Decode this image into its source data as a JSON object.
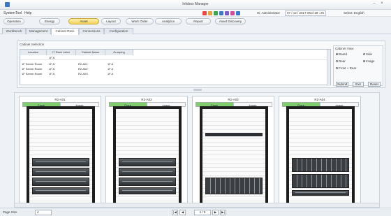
{
  "window": {
    "title": "Infobox Manager"
  },
  "menu": [
    "System",
    "Tool",
    "Help"
  ],
  "status": {
    "user": "Hi, Administrator",
    "datetime": "07 / 12 / 2017  Wed  19 : 25",
    "lang_label": "Select: English"
  },
  "toolbar": [
    "Operation",
    "Energy",
    "Asset",
    "Layout",
    "Work Order",
    "Analytics",
    "Report",
    "Asset Discovery"
  ],
  "tabs": [
    "Workbench",
    "Management",
    "Cabinet Rack",
    "Connections",
    "Configuration"
  ],
  "search": {
    "title": "Cabinet Selection",
    "columns": [
      "Location",
      "IT Rack Label",
      "Cabinet Name",
      "Grouping"
    ],
    "filter_value": "1F A",
    "rows": [
      {
        "location": "1F Server Room",
        "label": "1F A",
        "name": "R2-A01",
        "group": "1F A"
      },
      {
        "location": "1F Server Room",
        "label": "1F A",
        "name": "R2-A02",
        "group": "1F A"
      },
      {
        "location": "1F Server Room",
        "label": "1F A",
        "name": "R2-A03",
        "group": "1F A"
      }
    ]
  },
  "select_view": {
    "title": "Cabinet View",
    "options": [
      "Board",
      "Rear",
      "Front + Rear",
      "Side",
      "Image"
    ],
    "buttons": [
      "Submit",
      "Exit",
      "Reset"
    ]
  },
  "racks": [
    {
      "name": "R2-A01",
      "front": "Front",
      "image": "Image"
    },
    {
      "name": "R2-A02",
      "front": "Front",
      "image": "Image"
    },
    {
      "name": "R2-A03",
      "front": "Front",
      "image": "Image"
    },
    {
      "name": "R2-A04",
      "front": "Front",
      "image": "Image"
    }
  ],
  "pager": {
    "page_size_label": "Page Size",
    "page_size": "4",
    "prev": "◀",
    "first": "|◀",
    "page": "4 / 9",
    "next": "▶",
    "last": "▶|"
  },
  "colors": {
    "active": "#f3d25a",
    "front": "#7fd06d",
    "accent": "#3a78c8"
  }
}
